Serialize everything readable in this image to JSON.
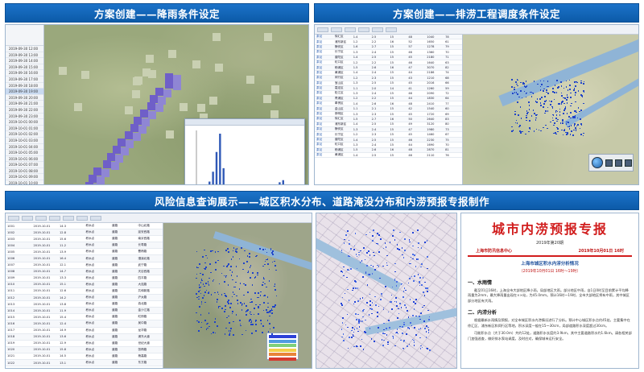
{
  "banners": {
    "rainfall": "方案创建——降雨条件设定",
    "drainage": "方案创建——排涝工程调度条件设定",
    "risk": "风险信息查询展示——城区积水分布、道路淹没分布和内涝预报专报制作"
  },
  "report": {
    "title": "城市内涝预报专报",
    "issue": "2019年第20期",
    "issuer": "上海市防汛信息中心",
    "issue_time": "2019年10月01日 16时",
    "subtitle": "上海市城区积水内涝分析情况",
    "period": "（2019年10月01日 16时～19时）",
    "section1_title": "一、水雨情",
    "section1_text": "截至01日16时，上海全市大部地区降小雨，局部地区大雨。部分地区中雨，自1日0时至目前累计平均降雨量为2mm，最大降雨量出现在××站，为45.0mm。预计16时～19时，全市大部地区将有中雨，其中城区部分地区有大雨。",
    "section2_title": "二、内涝分析",
    "section2_text": "根据最新水雨情及预报，对全市城区积水内涝情况进行了分析。预计中心城区积水点约45处，主要集中在徐汇区、浦东新区和闵行区等地，积水深度一般在15～30cm，局部道路积水深度超过30cm。",
    "section3_text": "可能积水点（大于30.0m）共约12处，道路积水长度约3.9km，其中主要道路积水约1.6km。请各相关部门加强巡查，做好排水泵站调度，及时应对，确保城市运行安全。"
  },
  "rain_chart": {
    "type": "bar",
    "values": [
      0,
      0,
      0,
      12,
      26,
      54,
      80,
      31,
      8,
      0,
      0,
      2,
      0,
      0,
      0,
      0,
      0,
      0,
      0,
      0,
      0,
      2,
      4,
      11,
      14,
      7,
      2,
      0
    ]
  },
  "rain_list": {
    "rows": [
      "2019-09-30 12:00",
      "2019-09-30 13:00",
      "2019-09-30 14:00",
      "2019-09-30 15:00",
      "2019-09-30 16:00",
      "2019-09-30 17:00",
      "2019-09-30 18:00",
      "2019-09-30 19:00",
      "2019-09-30 20:00",
      "2019-09-30 21:00",
      "2019-09-30 22:00",
      "2019-09-30 23:00",
      "2019-10-01 00:00",
      "2019-10-01 01:00",
      "2019-10-01 02:00",
      "2019-10-01 03:00",
      "2019-10-01 04:00",
      "2019-10-01 05:00",
      "2019-10-01 06:00",
      "2019-10-01 07:00",
      "2019-10-01 08:00",
      "2019-10-01 09:00",
      "2019-10-01 10:00",
      "2019-10-01 11:00"
    ]
  },
  "drain_table": {
    "rows": [
      [
        "泵站",
        "徐汇区",
        "1.4",
        "2.5",
        "15",
        "48",
        "1040",
        "78"
      ],
      [
        "泵站",
        "浦东新区",
        "1.2",
        "2.2",
        "16",
        "52",
        "1650",
        "61"
      ],
      [
        "泵站",
        "静安区",
        "1.6",
        "2.7",
        "15",
        "57",
        "1278",
        "79"
      ],
      [
        "泵站",
        "长宁区",
        "1.3",
        "2.4",
        "15",
        "46",
        "1360",
        "70"
      ],
      [
        "泵站",
        "普陀区",
        "1.4",
        "2.5",
        "15",
        "45",
        "2180",
        "71"
      ],
      [
        "泵站",
        "虹口区",
        "1.2",
        "2.2",
        "15",
        "46",
        "1640",
        "63"
      ],
      [
        "泵站",
        "杨浦区",
        "1.5",
        "2.6",
        "16",
        "47",
        "3070",
        "82"
      ],
      [
        "泵站",
        "黄浦区",
        "1.4",
        "2.4",
        "15",
        "44",
        "2186",
        "74"
      ],
      [
        "泵站",
        "闵行区",
        "1.2",
        "2.3",
        "15",
        "43",
        "1210",
        "68"
      ],
      [
        "泵站",
        "宝山区",
        "1.3",
        "2.5",
        "15",
        "45",
        "2016",
        "66"
      ],
      [
        "泵站",
        "嘉定区",
        "1.1",
        "2.0",
        "14",
        "41",
        "1260",
        "59"
      ],
      [
        "泵站",
        "松江区",
        "1.3",
        "2.4",
        "15",
        "46",
        "2090",
        "72"
      ],
      [
        "泵站",
        "青浦区",
        "1.2",
        "2.2",
        "15",
        "44",
        "1830",
        "64"
      ],
      [
        "泵站",
        "奉贤区",
        "1.4",
        "2.6",
        "16",
        "48",
        "2410",
        "77"
      ],
      [
        "泵站",
        "金山区",
        "1.1",
        "2.1",
        "15",
        "42",
        "1540",
        "60"
      ],
      [
        "泵站",
        "崇明区",
        "1.3",
        "2.3",
        "15",
        "45",
        "1720",
        "69"
      ],
      [
        "泵站",
        "徐汇区",
        "1.5",
        "2.7",
        "16",
        "50",
        "2640",
        "83"
      ],
      [
        "泵站",
        "浦东新区",
        "1.4",
        "2.5",
        "15",
        "49",
        "3120",
        "80"
      ],
      [
        "泵站",
        "静安区",
        "1.3",
        "2.4",
        "15",
        "47",
        "1980",
        "73"
      ],
      [
        "泵站",
        "长宁区",
        "1.2",
        "2.3",
        "15",
        "45",
        "1460",
        "67"
      ],
      [
        "泵站",
        "普陀区",
        "1.4",
        "2.5",
        "15",
        "46",
        "2230",
        "75"
      ],
      [
        "泵站",
        "虹口区",
        "1.3",
        "2.4",
        "15",
        "44",
        "1690",
        "70"
      ],
      [
        "泵站",
        "杨浦区",
        "1.5",
        "2.6",
        "16",
        "48",
        "2870",
        "81"
      ],
      [
        "泵站",
        "黄浦区",
        "1.4",
        "2.5",
        "15",
        "46",
        "2110",
        "76"
      ]
    ]
  },
  "risk_table": {
    "rows": [
      [
        "1001",
        "2019-10-01",
        "14.3",
        "积水点",
        "道路",
        "中山北路"
      ],
      [
        "1002",
        "2019-10-01",
        "12.8",
        "积水点",
        "道路",
        "延安西路"
      ],
      [
        "1003",
        "2019-10-01",
        "15.6",
        "积水点",
        "道路",
        "南京西路"
      ],
      [
        "1004",
        "2019-10-01",
        "11.2",
        "积水点",
        "道路",
        "长寿路"
      ],
      [
        "1005",
        "2019-10-01",
        "13.9",
        "积水点",
        "道路",
        "曹杨路"
      ],
      [
        "1006",
        "2019-10-01",
        "16.4",
        "积水点",
        "道路",
        "漕溪北路"
      ],
      [
        "1007",
        "2019-10-01",
        "12.1",
        "积水点",
        "道路",
        "武宁路"
      ],
      [
        "1008",
        "2019-10-01",
        "14.7",
        "积水点",
        "道路",
        "天目西路"
      ],
      [
        "1009",
        "2019-10-01",
        "13.3",
        "积水点",
        "道路",
        "四平路"
      ],
      [
        "1010",
        "2019-10-01",
        "15.1",
        "积水点",
        "道路",
        "大连路"
      ],
      [
        "1011",
        "2019-10-01",
        "12.6",
        "积水点",
        "道路",
        "共和新路"
      ],
      [
        "1012",
        "2019-10-01",
        "14.2",
        "积水点",
        "道路",
        "沪太路"
      ],
      [
        "1013",
        "2019-10-01",
        "13.8",
        "积水点",
        "道路",
        "真北路"
      ],
      [
        "1014",
        "2019-10-01",
        "11.9",
        "积水点",
        "道路",
        "金沙江路"
      ],
      [
        "1015",
        "2019-10-01",
        "15.4",
        "积水点",
        "道路",
        "虹桥路"
      ],
      [
        "1016",
        "2019-10-01",
        "12.4",
        "积水点",
        "道路",
        "吴中路"
      ],
      [
        "1017",
        "2019-10-01",
        "14.9",
        "积水点",
        "道路",
        "龙华路"
      ],
      [
        "1018",
        "2019-10-01",
        "13.6",
        "积水点",
        "道路",
        "浦东大道"
      ],
      [
        "1019",
        "2019-10-01",
        "12.9",
        "积水点",
        "道路",
        "世纪大道"
      ],
      [
        "1020",
        "2019-10-01",
        "15.8",
        "积水点",
        "道路",
        "张杨路"
      ],
      [
        "1021",
        "2019-10-01",
        "14.5",
        "积水点",
        "道路",
        "杨高路"
      ],
      [
        "1022",
        "2019-10-01",
        "13.1",
        "积水点",
        "道路",
        "东方路"
      ]
    ]
  },
  "risk_legend": {
    "colors": [
      "#2c40d8",
      "#4f9be0",
      "#7fd07a",
      "#f3d04a",
      "#e8843a",
      "#d63a2f"
    ]
  }
}
